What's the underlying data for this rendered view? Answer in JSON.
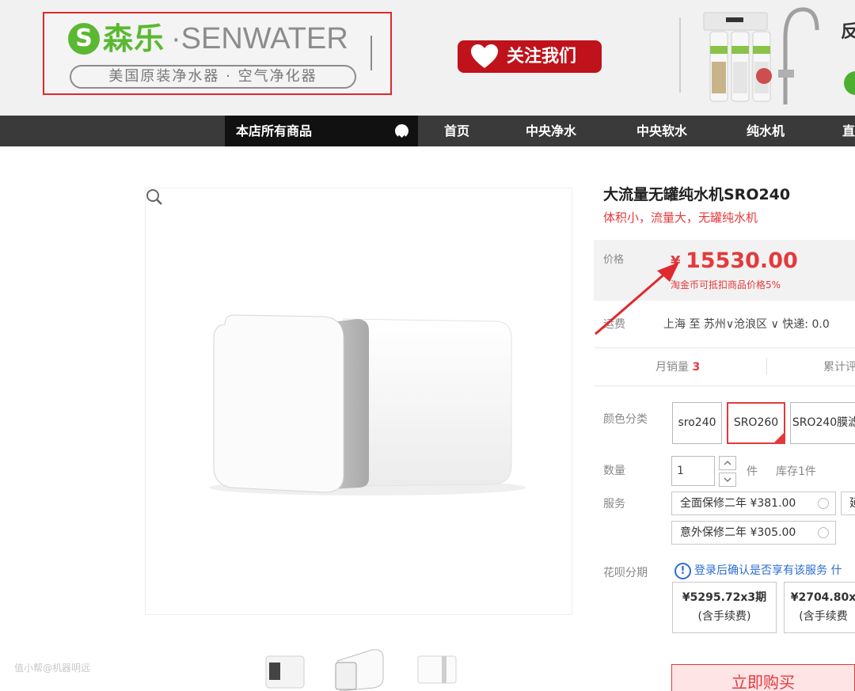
{
  "header": {
    "logo_letter": "S",
    "logo_cn": "森乐",
    "logo_en": "·SENWATER",
    "logo_sub": "美国原装净水器 · 空气净化器",
    "follow_label": "关注我们",
    "side_text": "反"
  },
  "nav": {
    "all_products": "本店所有商品",
    "items": [
      "首页",
      "中央净水",
      "中央软水",
      "纯水机",
      "直"
    ]
  },
  "product": {
    "title": "大流量无罐纯水机SRO240",
    "subtitle": "体积小，流量大，无罐纯水机",
    "price_label": "价格",
    "currency": "¥",
    "price": "15530.00",
    "price_note": "淘金币可抵扣商品价格5%",
    "shipping_label": "运费",
    "shipping_value": "上海 至 苏州∨沧浪区 ∨ 快递: 0.0",
    "monthly_sales_label": "月销量",
    "monthly_sales": "3",
    "reviews_label": "累计评",
    "color_label": "颜色分类",
    "colors": [
      "sro240",
      "SRO260",
      "SRO240膜滤"
    ],
    "selected_color": "SRO260",
    "qty_label": "数量",
    "qty_value": "1",
    "qty_unit": "件",
    "stock": "库存1件",
    "service_label": "服务",
    "services": [
      "全面保修二年 ¥381.00",
      "意外保修二年 ¥305.00",
      "延"
    ],
    "huabei_label": "花呗分期",
    "huabei_note": "登录后确认是否享有该服务",
    "huabei_link": "什",
    "installments": [
      {
        "amount": "¥5295.72x3期",
        "fee": "(含手续费)"
      },
      {
        "amount": "¥2704.80x",
        "fee": "(含手续费"
      }
    ],
    "buy_label": "立即购买"
  },
  "watermark": "值小帮@机器明远",
  "colors": {
    "accent_red": "#e4393c",
    "brand_green": "#5bb832",
    "nav_bg": "#3a3a3a",
    "link_blue": "#2b6cd4"
  }
}
